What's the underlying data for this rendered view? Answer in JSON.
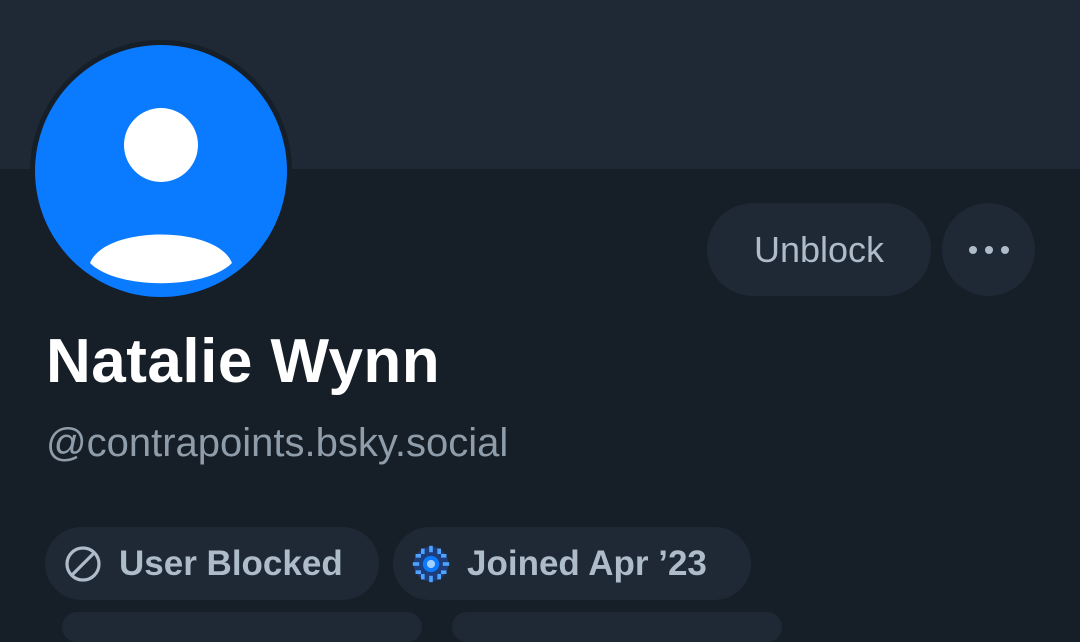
{
  "profile": {
    "display_name": "Natalie Wynn",
    "handle": "@contrapoints.bsky.social",
    "avatar_icon": "default-user-avatar-icon",
    "avatar_color": "#0a7aff"
  },
  "actions": {
    "unblock_label": "Unblock",
    "more_icon": "ellipsis-icon"
  },
  "badges": {
    "blocked_label": "User Blocked",
    "blocked_icon": "blocked-circle-icon",
    "joined_label": "Joined Apr ’23",
    "joined_icon": "new-user-badge-icon"
  },
  "colors": {
    "background": "#161e27",
    "banner": "#1e2935",
    "pill": "#1e2935",
    "text_primary": "#ffffff",
    "text_secondary": "#8f9dab",
    "button_text": "#aebbc9"
  }
}
